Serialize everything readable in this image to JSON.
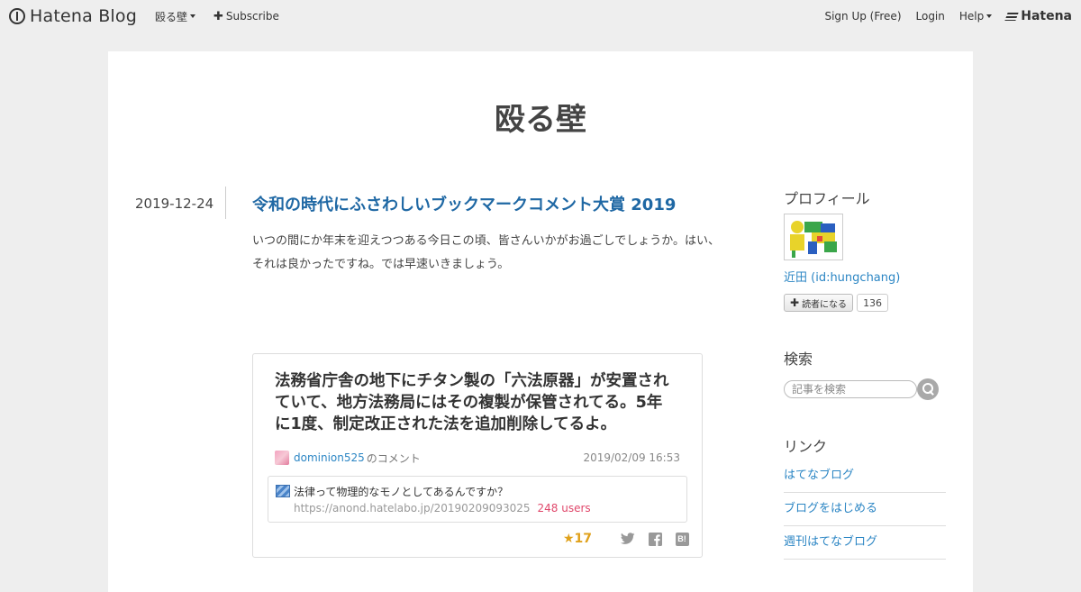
{
  "topbar": {
    "brand": "Hatena Blog",
    "blog_menu": "殴る壁",
    "subscribe": "Subscribe",
    "signup": "Sign Up (Free)",
    "login": "Login",
    "help": "Help",
    "hatena": "Hatena"
  },
  "blog": {
    "title": "殴る壁"
  },
  "entry": {
    "date": "2019-12-24",
    "title": "令和の時代にふさわしいブックマークコメント大賞 2019",
    "body_line1": "いつの間にか年末を迎えつつある今日この頃、皆さんいかがお過ごしでしょうか。はい、",
    "body_line2": "それは良かったですね。では早速いきましょう。"
  },
  "bookmark_card": {
    "quote_line1": "法務省庁舎の地下にチタン製の「六法原器」が安置され",
    "quote_line2": "ていて、地方法務局にはその複製が保管されてる。5年",
    "quote_line3": "に1度、制定改正された法を追加削除してるよ。",
    "username": "dominion525",
    "comment_suffix": "のコメント",
    "time": "2019/02/09 16:53",
    "ref_title": "法律って物理的なモノとしてあるんですか？",
    "ref_url": "https://anond.hatelabo.jp/20190209093025",
    "ref_users": "248 users",
    "stars": "★17"
  },
  "sidebar": {
    "profile_heading": "プロフィール",
    "profile_name": "近田 (id:hungchang)",
    "subscribe_label": "読者になる",
    "subscriber_count": "136",
    "search_heading": "検索",
    "search_placeholder": "記事を検索",
    "links_heading": "リンク",
    "links": [
      "はてなブログ",
      "ブログをはじめる",
      "週刊はてなブログ"
    ]
  },
  "colors": {
    "link": "#2c86c4",
    "entry_title": "#1f68a4",
    "users": "#e0486b",
    "star": "#e0a11b",
    "background": "#eeeeee"
  }
}
